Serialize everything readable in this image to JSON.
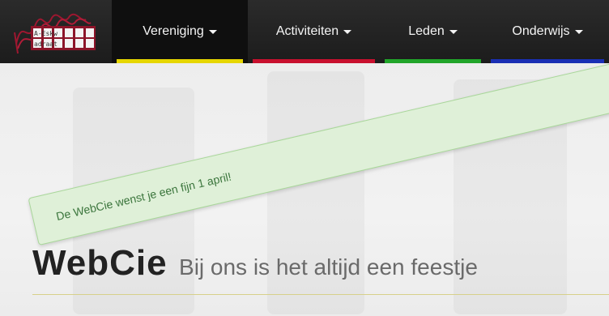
{
  "brand": {
    "logo_text_top": "A-Eskw",
    "logo_text_bottom": "adraat"
  },
  "nav": {
    "items": [
      {
        "label": "Vereniging",
        "bar_color": "#e6d600"
      },
      {
        "label": "Activiteiten",
        "bar_color": "#c8102e"
      },
      {
        "label": "Leden",
        "bar_color": "#21a52a"
      },
      {
        "label": "Onderwijs",
        "bar_color": "#1a2fb4"
      }
    ]
  },
  "hero": {
    "title": "WebCie",
    "subtitle": "Bij ons is het altijd een feestje"
  },
  "alert": {
    "message": "De WebCie wenst je een fijn 1 april!"
  }
}
